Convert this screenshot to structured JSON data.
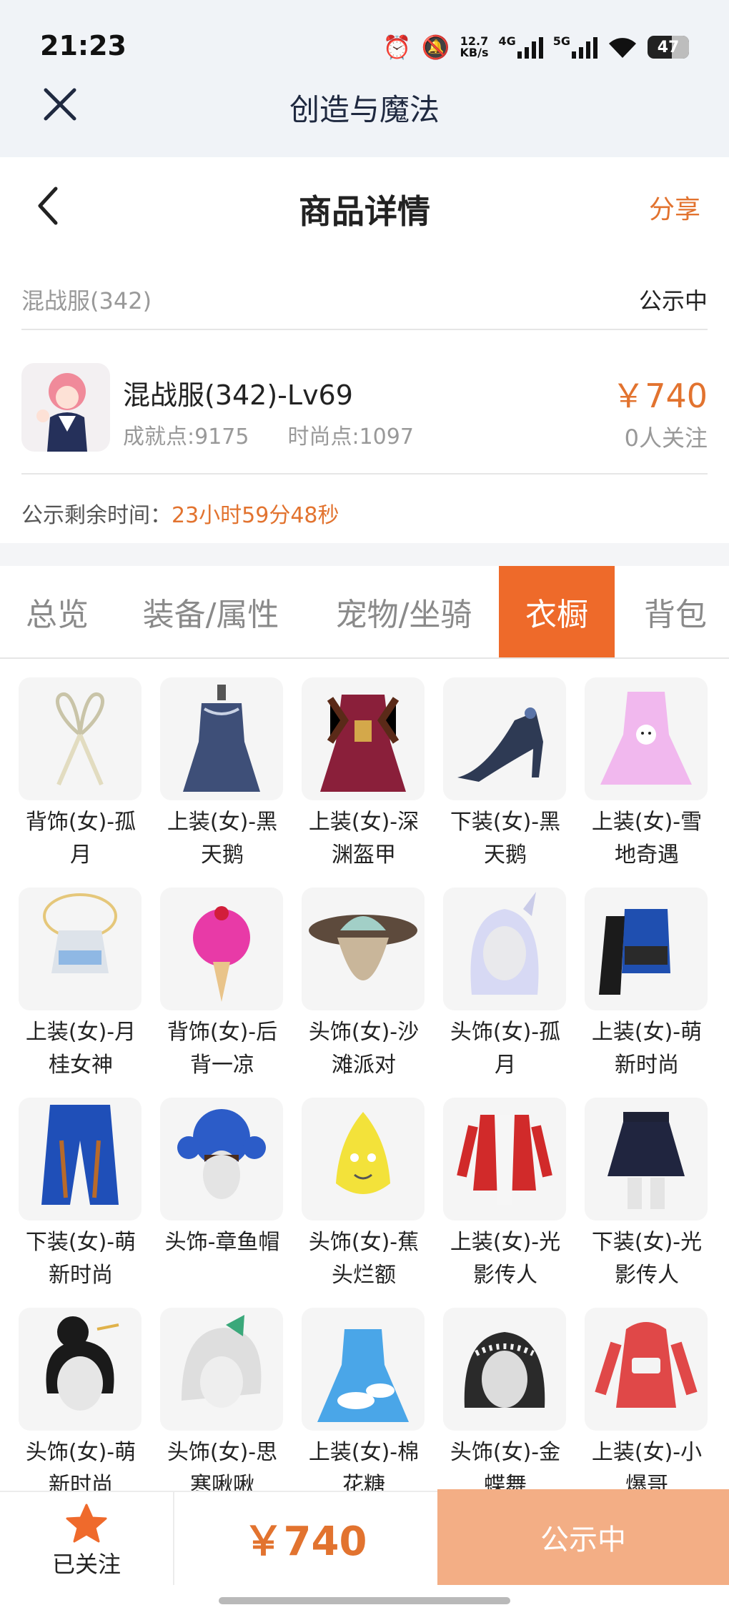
{
  "status_bar": {
    "time": "21:23",
    "network_speed_top": "12.7",
    "network_speed_unit": "KB/s",
    "signal_1": "4G",
    "signal_2": "5G",
    "battery": "47",
    "icons": [
      "alarm-icon",
      "mute-bell-icon",
      "signal-icon",
      "wifi-icon",
      "battery-icon"
    ]
  },
  "app_header": {
    "title": "创造与魔法",
    "close_icon": "close-icon"
  },
  "page_header": {
    "title": "商品详情",
    "share": "分享",
    "back_icon": "chevron-left-icon"
  },
  "server": {
    "name": "混战服(342)",
    "status": "公示中"
  },
  "character": {
    "name": "混战服(342)-Lv69",
    "achievement": "成就点:9175",
    "fashion": "时尚点:1097",
    "price": "￥740",
    "followers": "0人关注"
  },
  "countdown": {
    "label": "公示剩余时间：",
    "value": "23小时59分48秒"
  },
  "tabs": [
    {
      "label": "总览",
      "active": false
    },
    {
      "label": "装备/属性",
      "active": false
    },
    {
      "label": "宠物/坐骑",
      "active": false
    },
    {
      "label": "衣橱",
      "active": true
    },
    {
      "label": "背包",
      "active": false
    }
  ],
  "wardrobe": [
    {
      "name": "背饰(女)-孤月",
      "icon": "ribbon-back-accessory"
    },
    {
      "name": "上装(女)-黑天鹅",
      "icon": "dark-gown"
    },
    {
      "name": "上装(女)-深渊盔甲",
      "icon": "armor-dress"
    },
    {
      "name": "下装(女)-黑天鹅",
      "icon": "high-heel-shoes"
    },
    {
      "name": "上装(女)-雪地奇遇",
      "icon": "pink-snow-dress"
    },
    {
      "name": "上装(女)-月桂女神",
      "icon": "goddess-top"
    },
    {
      "name": "背饰(女)-后背一凉",
      "icon": "ice-cream-back"
    },
    {
      "name": "头饰(女)-沙滩派对",
      "icon": "beach-hat"
    },
    {
      "name": "头饰(女)-孤月",
      "icon": "moon-hair"
    },
    {
      "name": "上装(女)-萌新时尚",
      "icon": "blue-corset-top"
    },
    {
      "name": "下装(女)-萌新时尚",
      "icon": "blue-pants"
    },
    {
      "name": "头饰-章鱼帽",
      "icon": "octopus-hat"
    },
    {
      "name": "头饰(女)-蕉头烂额",
      "icon": "banana-hat"
    },
    {
      "name": "上装(女)-光影传人",
      "icon": "red-jacket"
    },
    {
      "name": "下装(女)-光影传人",
      "icon": "pleated-skirt"
    },
    {
      "name": "头饰(女)-萌新时尚",
      "icon": "black-bun-hair"
    },
    {
      "name": "头饰(女)-思寒啾啾",
      "icon": "white-green-hair"
    },
    {
      "name": "上装(女)-棉花糖",
      "icon": "cloud-dress"
    },
    {
      "name": "头饰(女)-金蝶舞",
      "icon": "pearl-headband"
    },
    {
      "name": "上装(女)-小爆哥",
      "icon": "red-hoodie"
    }
  ],
  "bottom_bar": {
    "follow_label": "已关注",
    "price": "￥740",
    "action": "公示中"
  },
  "colors": {
    "accent": "#ee6a2a",
    "price": "#e2732f",
    "button_disabled": "#f3ae85"
  }
}
